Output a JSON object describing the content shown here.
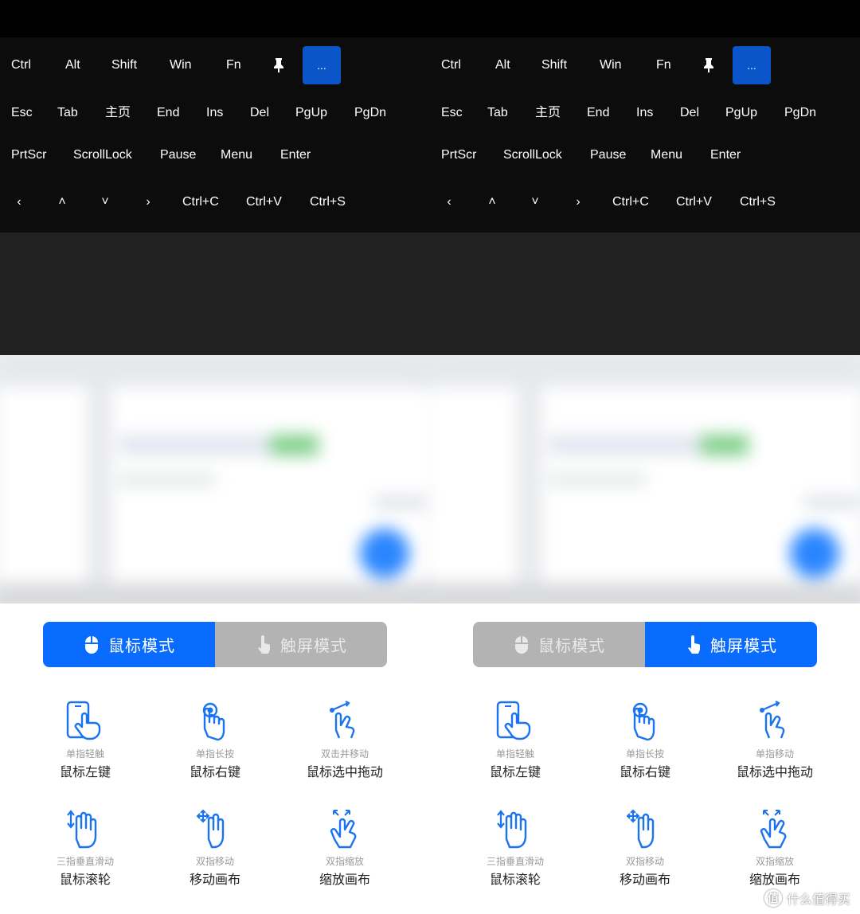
{
  "keyboard": {
    "row1": [
      "Ctrl",
      "Alt",
      "Shift",
      "Win",
      "Fn"
    ],
    "more_label": "...",
    "row2": [
      "Esc",
      "Tab",
      "主页",
      "End",
      "Ins",
      "Del",
      "PgUp",
      "PgDn"
    ],
    "row3": [
      "PrtScr",
      "ScrollLock",
      "Pause",
      "Menu",
      "Enter"
    ],
    "row4_arrows": [
      "‹",
      "˄",
      "˅",
      "›"
    ],
    "row4_shortcuts": [
      "Ctrl+C",
      "Ctrl+V",
      "Ctrl+S"
    ],
    "more_button_color": "#0a55c8"
  },
  "modes": {
    "mouse_label": "鼠标模式",
    "touch_label": "触屏模式",
    "active_color": "#0a6cff",
    "inactive_color": "#b3b3b3"
  },
  "left_panel": {
    "active_mode": "mouse",
    "gestures": [
      {
        "icon": "single-tap-phone-icon",
        "sub": "单指轻触",
        "main": "鼠标左键"
      },
      {
        "icon": "long-press-icon",
        "sub": "单指长按",
        "main": "鼠标右键"
      },
      {
        "icon": "double-tap-drag-icon",
        "sub": "双击并移动",
        "main": "鼠标选中拖动"
      },
      {
        "icon": "three-finger-scroll-icon",
        "sub": "三指垂直滑动",
        "main": "鼠标滚轮"
      },
      {
        "icon": "two-finger-move-icon",
        "sub": "双指移动",
        "main": "移动画布"
      },
      {
        "icon": "pinch-zoom-icon",
        "sub": "双指缩放",
        "main": "缩放画布"
      }
    ]
  },
  "right_panel": {
    "active_mode": "touch",
    "gestures": [
      {
        "icon": "single-tap-phone-icon",
        "sub": "单指轻触",
        "main": "鼠标左键"
      },
      {
        "icon": "long-press-icon",
        "sub": "单指长按",
        "main": "鼠标右键"
      },
      {
        "icon": "single-finger-move-icon",
        "sub": "单指移动",
        "main": "鼠标选中拖动"
      },
      {
        "icon": "three-finger-scroll-icon",
        "sub": "三指垂直滑动",
        "main": "鼠标滚轮"
      },
      {
        "icon": "two-finger-move-icon",
        "sub": "双指移动",
        "main": "移动画布"
      },
      {
        "icon": "pinch-zoom-icon",
        "sub": "双指缩放",
        "main": "缩放画布"
      }
    ]
  },
  "watermark": {
    "glyph": "值",
    "text": "什么值得买"
  }
}
